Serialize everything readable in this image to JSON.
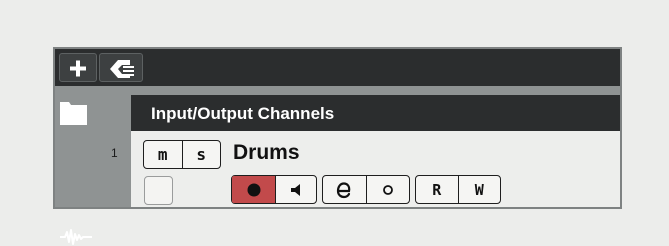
{
  "toolbar": {
    "add_button_icon": "plus-icon",
    "preset_button_icon": "track-preset-icon"
  },
  "folder": {
    "icon": "folder-icon",
    "title": "Input/Output Channels"
  },
  "track": {
    "number": "1",
    "icon": "waveform-icon",
    "mute_label": "m",
    "solo_label": "s",
    "name": "Drums",
    "read_label": "R",
    "write_label": "W"
  },
  "colors": {
    "toolbar_bg": "#2b2d2e",
    "panel_gray": "#8f9393",
    "record_red": "#c24a4b",
    "track_bg": "#edeeec"
  }
}
